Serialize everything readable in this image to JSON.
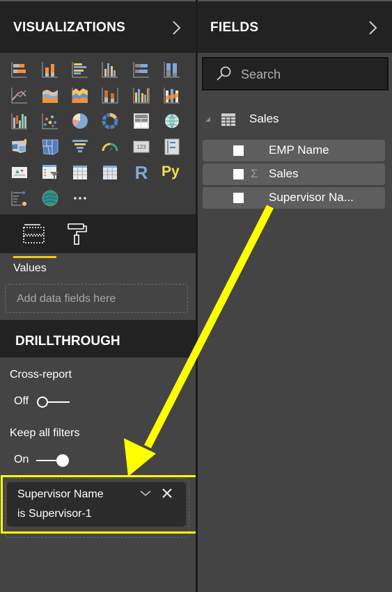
{
  "visualizations_pane": {
    "title": "VISUALIZATIONS",
    "collapse_icon": "chevron-right-icon",
    "gallery": [
      [
        "stacked-bar-chart",
        "stacked-column-chart",
        "clustered-bar-chart",
        "clustered-column-chart",
        "100-stacked-bar-chart",
        "100-stacked-column-chart"
      ],
      [
        "line-chart",
        "area-chart",
        "stacked-area-chart",
        "line-and-stacked-column-chart",
        "line-and-clustered-column-chart",
        "ribbon-chart"
      ],
      [
        "waterfall-chart",
        "scatter-chart",
        "pie-chart",
        "donut-chart",
        "treemap",
        "map"
      ],
      [
        "filled-map",
        "shape-map",
        "funnel",
        "gauge",
        "card",
        "multi-row-card"
      ],
      [
        "kpi",
        "slicer",
        "table",
        "matrix",
        "r-script-visual",
        "python-visual"
      ],
      [
        "key-influencers",
        "arcgis-map",
        "more-visuals"
      ]
    ],
    "r_label": "R",
    "py_label": "Py",
    "more_label": "···",
    "tabs": [
      {
        "name": "fields-tab",
        "icon": "fields-well-icon",
        "active": true
      },
      {
        "name": "format-tab",
        "icon": "paint-roller-icon",
        "active": false
      }
    ],
    "values_well": {
      "label": "Values",
      "placeholder": "Add data fields here"
    },
    "drillthrough": {
      "title": "DRILLTHROUGH",
      "cross_report": {
        "label": "Cross-report",
        "state": "Off"
      },
      "keep_all_filters": {
        "label": "Keep all filters",
        "state": "On"
      },
      "filter_card": {
        "field": "Supervisor Name",
        "condition": "is Supervisor-1"
      }
    }
  },
  "fields_pane": {
    "title": "FIELDS",
    "collapse_icon": "chevron-right-icon",
    "search_placeholder": "Search",
    "tables": [
      {
        "name": "Sales",
        "expanded": true,
        "fields": [
          {
            "name": "EMP Name",
            "checked": false,
            "aggregate": false
          },
          {
            "name": "Sales",
            "checked": false,
            "aggregate": true,
            "aggregate_symbol": "Σ"
          },
          {
            "name": "Supervisor Na...",
            "checked": false,
            "aggregate": false
          }
        ]
      }
    ]
  },
  "colors": {
    "pane_bg": "#444444",
    "header_bg": "#222222",
    "accent_underline": "#f2c811",
    "annotation": "#ffff00",
    "field_row": "#5e5e5e"
  }
}
